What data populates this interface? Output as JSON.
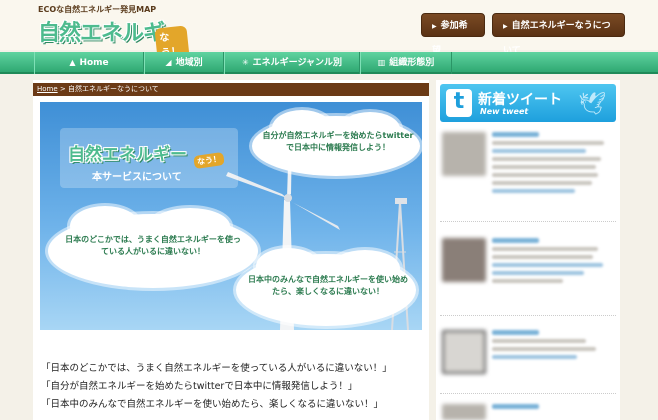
{
  "header": {
    "tagline": "ECOな自然エネルギー発見MAP",
    "logo_main": "自然エネルギー",
    "logo_sub": "なう！",
    "buttons": [
      {
        "label": "参加希望"
      },
      {
        "label": "自然エネルギーなうについて"
      }
    ]
  },
  "nav": {
    "items": [
      {
        "label": "Home"
      },
      {
        "label": "地域別"
      },
      {
        "label": "エネルギージャンル別"
      },
      {
        "label": "組織形態別"
      }
    ]
  },
  "breadcrumb": {
    "home": "Home",
    "separator": ">",
    "current": "自然エネルギーなうについて"
  },
  "hero": {
    "logo_main": "自然エネルギー",
    "logo_sub": "なう！",
    "subtitle": "本サービスについて",
    "bubble1": "自分が自然エネルギーを始めたらtwitterで日本中に情報発信しよう！",
    "bubble2": "日本のどこかでは、うまく自然エネルギーを使っている人がいるに違いない！",
    "bubble3": "日本中のみんなで自然エネルギーを使い始めたら、楽しくなるに違いない！"
  },
  "body": {
    "lines": [
      "「日本のどこかでは、うまく自然エネルギーを使っている人がいるに違いない！」",
      "「自分が自然エネルギーを始めたらtwitterで日本中に情報発信しよう！」",
      "「日本中のみんなで自然エネルギーを使い始めたら、楽しくなるに違いない！」"
    ]
  },
  "sidebar": {
    "twitter_title": "新着ツイート",
    "twitter_sub": "New tweet"
  },
  "colors": {
    "brand_green": "#4dbb8e",
    "nav_green": "#2fa872",
    "brown": "#6b3a16",
    "twitter_blue": "#1ea0dd"
  }
}
